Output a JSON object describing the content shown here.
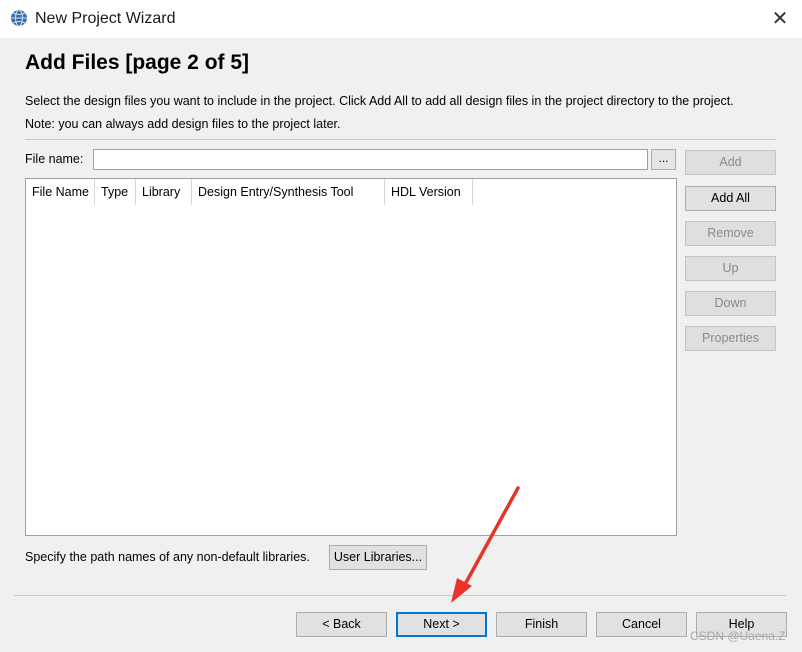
{
  "window": {
    "title": "New Project Wizard",
    "close_glyph": "✕",
    "icon": "app-globe-icon"
  },
  "page": {
    "heading": "Add Files [page 2 of 5]",
    "description": "Select the design files you want to include in the project. Click Add All to add all design files in the project directory to the project.",
    "note": "Note: you can always add design files to the project later."
  },
  "file_name": {
    "label": "File name:",
    "value": "",
    "browse_label": "..."
  },
  "table": {
    "columns": [
      "File Name",
      "Type",
      "Library",
      "Design Entry/Synthesis Tool",
      "HDL Version"
    ],
    "rows": []
  },
  "side_buttons": {
    "add": "Add",
    "add_all": "Add All",
    "remove": "Remove",
    "up": "Up",
    "down": "Down",
    "properties": "Properties"
  },
  "libraries": {
    "text": "Specify the path names of any non-default libraries.",
    "button": "User Libraries..."
  },
  "footer": {
    "back": "< Back",
    "next": "Next >",
    "finish": "Finish",
    "cancel": "Cancel",
    "help": "Help"
  },
  "watermark": "CSDN @Uaena.Z",
  "colors": {
    "annotation_arrow": "#e8332a",
    "focus_border": "#0078d7"
  }
}
